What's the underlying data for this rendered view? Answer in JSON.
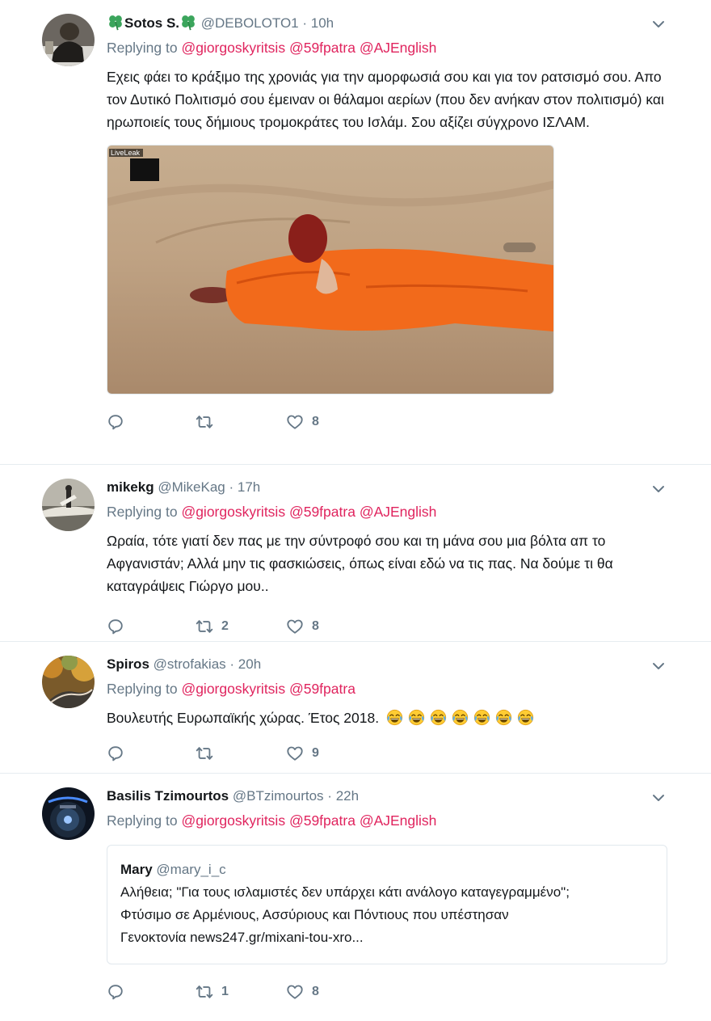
{
  "tweets": [
    {
      "name": "Sotos S.",
      "handle": "@DEBOLOTO1",
      "time": "10h",
      "replying_label": "Replying to",
      "mentions": [
        "@giorgoskyritsis",
        "@59fpatra",
        "@AJEnglish"
      ],
      "text": "Εχεις φάει το κράξιμο της χρονιάς για την αμορφωσιά σου και για τον ρατσισμό σου.  Απο τον Δυτικό Πολιτισμό σου έμειναν οι θάλαμοι αερίων (που δεν ανήκαν στον πολιτισμό) και ηρωποιείς τους δήμιους τρομοκράτες του Ισλάμ. Σου αξίζει σύγχρονο ΙΣΛΑΜ.",
      "media_watermark": "LiveLeak",
      "retweets": "",
      "likes": "8"
    },
    {
      "name": "mikekg",
      "handle": "@MikeKag",
      "time": "17h",
      "replying_label": "Replying to",
      "mentions": [
        "@giorgoskyritsis",
        "@59fpatra",
        "@AJEnglish"
      ],
      "text": "Ωραία, τότε γιατί δεν πας με την σύντροφό σου και τη μάνα σου μια βόλτα απ το Αφγανιστάν; Αλλά μην τις φασκιώσεις, όπως είναι εδώ να τις πας. Να δούμε τι θα καταγράψεις Γιώργο μου..",
      "retweets": "2",
      "likes": "8"
    },
    {
      "name": "Spiros",
      "handle": "@strofakias",
      "time": "20h",
      "replying_label": "Replying to",
      "mentions": [
        "@giorgoskyritsis",
        "@59fpatra"
      ],
      "text": "Βουλευτής Ευρωπαϊκής χώρας. Έτος 2018.",
      "emoji": "face-with-tears-of-joy x7",
      "retweets": "",
      "likes": "9"
    },
    {
      "name": "Basilis Tzimourtos",
      "handle": "@BTzimourtos",
      "time": "22h",
      "replying_label": "Replying to",
      "mentions": [
        "@giorgoskyritsis",
        "@59fpatra",
        "@AJEnglish"
      ],
      "quote": {
        "name": "Mary",
        "handle": "@mary_i_c",
        "line1": "Αλήθεια; \"Για τους ισλαμιστές δεν υπάρχει κάτι ανάλογο καταγεγραμμένο\";",
        "line2": "Φτύσιμο σε Αρμένιους, Ασσύριους και Πόντιους που υπέστησαν",
        "line3": "Γενοκτονία news247.gr/mixani-tou-xro..."
      },
      "retweets": "1",
      "likes": "8"
    }
  ],
  "colors": {
    "mention": "#e0245e",
    "muted": "#657786",
    "clover": "#3ba55c"
  },
  "icons": [
    "reply-icon",
    "retweet-icon",
    "like-icon",
    "chevron-down-icon",
    "clover-icon",
    "face-with-tears-of-joy-icon"
  ]
}
